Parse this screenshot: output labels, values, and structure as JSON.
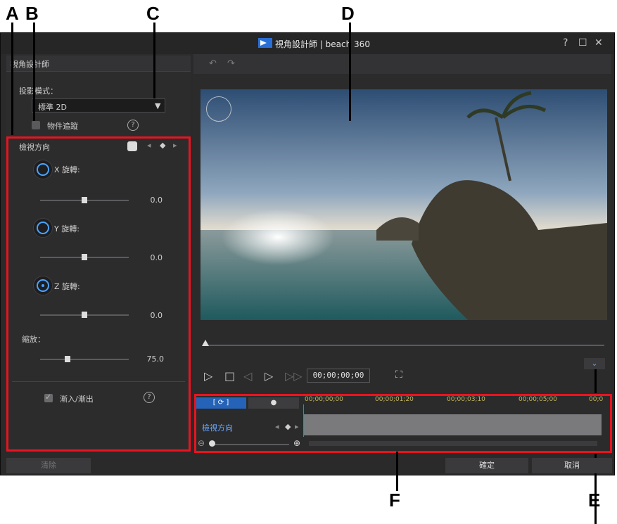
{
  "callouts": {
    "a": "A",
    "b": "B",
    "c": "C",
    "d": "D",
    "e": "E",
    "f": "F"
  },
  "window": {
    "title": "視角設計師 | beach 360",
    "help_glyph": "?",
    "max_glyph": "☐",
    "close_glyph": "✕"
  },
  "left_panel": {
    "header": "視角設計師",
    "projection_label": "投影模式：",
    "projection_value": "標準 2D",
    "object_tracking_label": "物件追蹤",
    "view_direction_label": "檢視方向",
    "rotations": [
      {
        "label": "X 旋轉:",
        "value": "0.0",
        "level": 0.5
      },
      {
        "label": "Y 旋轉:",
        "value": "0.0",
        "level": 0.5
      },
      {
        "label": "Z 旋轉:",
        "value": "0.0",
        "level": 0.5
      }
    ],
    "zoom_label": "縮放：",
    "zoom_value": "75.0",
    "fade_label": "漸入/漸出"
  },
  "preview": {
    "timecode": "00;00;00;00"
  },
  "timeline": {
    "tab1": "[ ⟳ ]",
    "ticks": [
      "00;00;00;00",
      "00;00;01;20",
      "00;00;03;10",
      "00;00;05;00",
      "00;0"
    ],
    "track_label": "檢視方向"
  },
  "buttons": {
    "clear": "清除",
    "ok": "確定",
    "cancel": "取消"
  }
}
